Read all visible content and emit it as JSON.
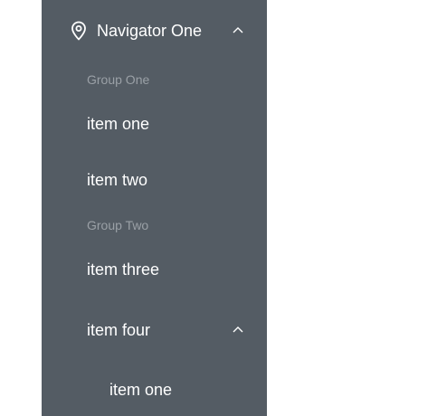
{
  "menu": {
    "submenu": {
      "icon": "location-pin-icon",
      "label": "Navigator One",
      "expanded": true
    },
    "groups": [
      {
        "title": "Group One",
        "items": [
          {
            "label": "item one"
          },
          {
            "label": "item two"
          }
        ]
      },
      {
        "title": "Group Two",
        "items": [
          {
            "label": "item three"
          }
        ]
      }
    ],
    "nested_submenu": {
      "label": "item four",
      "expanded": true,
      "items": [
        {
          "label": "item one"
        }
      ]
    }
  },
  "colors": {
    "menu_background": "#545c64",
    "text": "#ffffff",
    "group_title": "#9aa0a6",
    "page_background": "#ffffff"
  }
}
